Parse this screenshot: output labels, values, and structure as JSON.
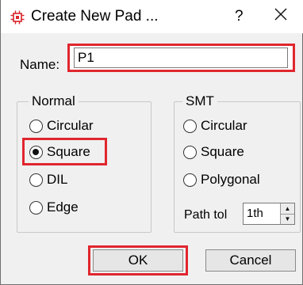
{
  "window": {
    "title": "Create New Pad ...",
    "help_label": "?",
    "app_icon": "chip-icon",
    "close_icon": "close-icon"
  },
  "name": {
    "label": "Name:",
    "value": "P1"
  },
  "normal": {
    "legend": "Normal",
    "options": [
      "Circular",
      "Square",
      "DIL",
      "Edge"
    ],
    "selected": "Square"
  },
  "smt": {
    "legend": "SMT",
    "options": [
      "Circular",
      "Square",
      "Polygonal"
    ],
    "path_tol_label": "Path tol",
    "path_tol_value": "1th"
  },
  "buttons": {
    "ok": "OK",
    "cancel": "Cancel"
  },
  "colors": {
    "highlight": "#e0262e",
    "icon": "#d9232b"
  }
}
